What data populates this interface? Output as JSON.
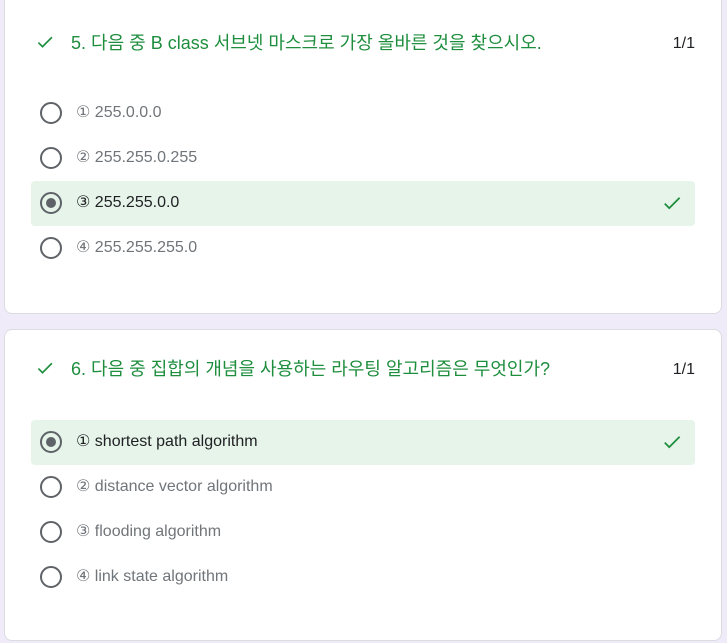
{
  "questions": [
    {
      "title": "5. 다음 중 B class 서브넷 마스크로 가장 올바른 것을 찾으시오.",
      "score": "1/1",
      "status": "correct",
      "options": [
        {
          "label": "① 255.0.0.0",
          "selected": false
        },
        {
          "label": "② 255.255.0.255",
          "selected": false
        },
        {
          "label": "③ 255.255.0.0",
          "selected": true,
          "correct": true
        },
        {
          "label": "④ 255.255.255.0",
          "selected": false
        }
      ]
    },
    {
      "title": "6. 다음 중 집합의 개념을 사용하는 라우팅 알고리즘은 무엇인가?",
      "score": "1/1",
      "status": "correct",
      "options": [
        {
          "label": "① shortest path algorithm",
          "selected": true,
          "correct": true
        },
        {
          "label": "② distance vector algorithm",
          "selected": false
        },
        {
          "label": "③ flooding algorithm",
          "selected": false
        },
        {
          "label": "④ link state algorithm",
          "selected": false
        }
      ]
    }
  ],
  "colors": {
    "correct_green": "#1e8e3e",
    "correct_bg": "#e6f4ea",
    "page_bg": "#f0ebf8",
    "radio_gray": "#5f6368"
  },
  "icons": {
    "question_status": "checkmark-icon",
    "option_correct": "checkmark-icon"
  }
}
